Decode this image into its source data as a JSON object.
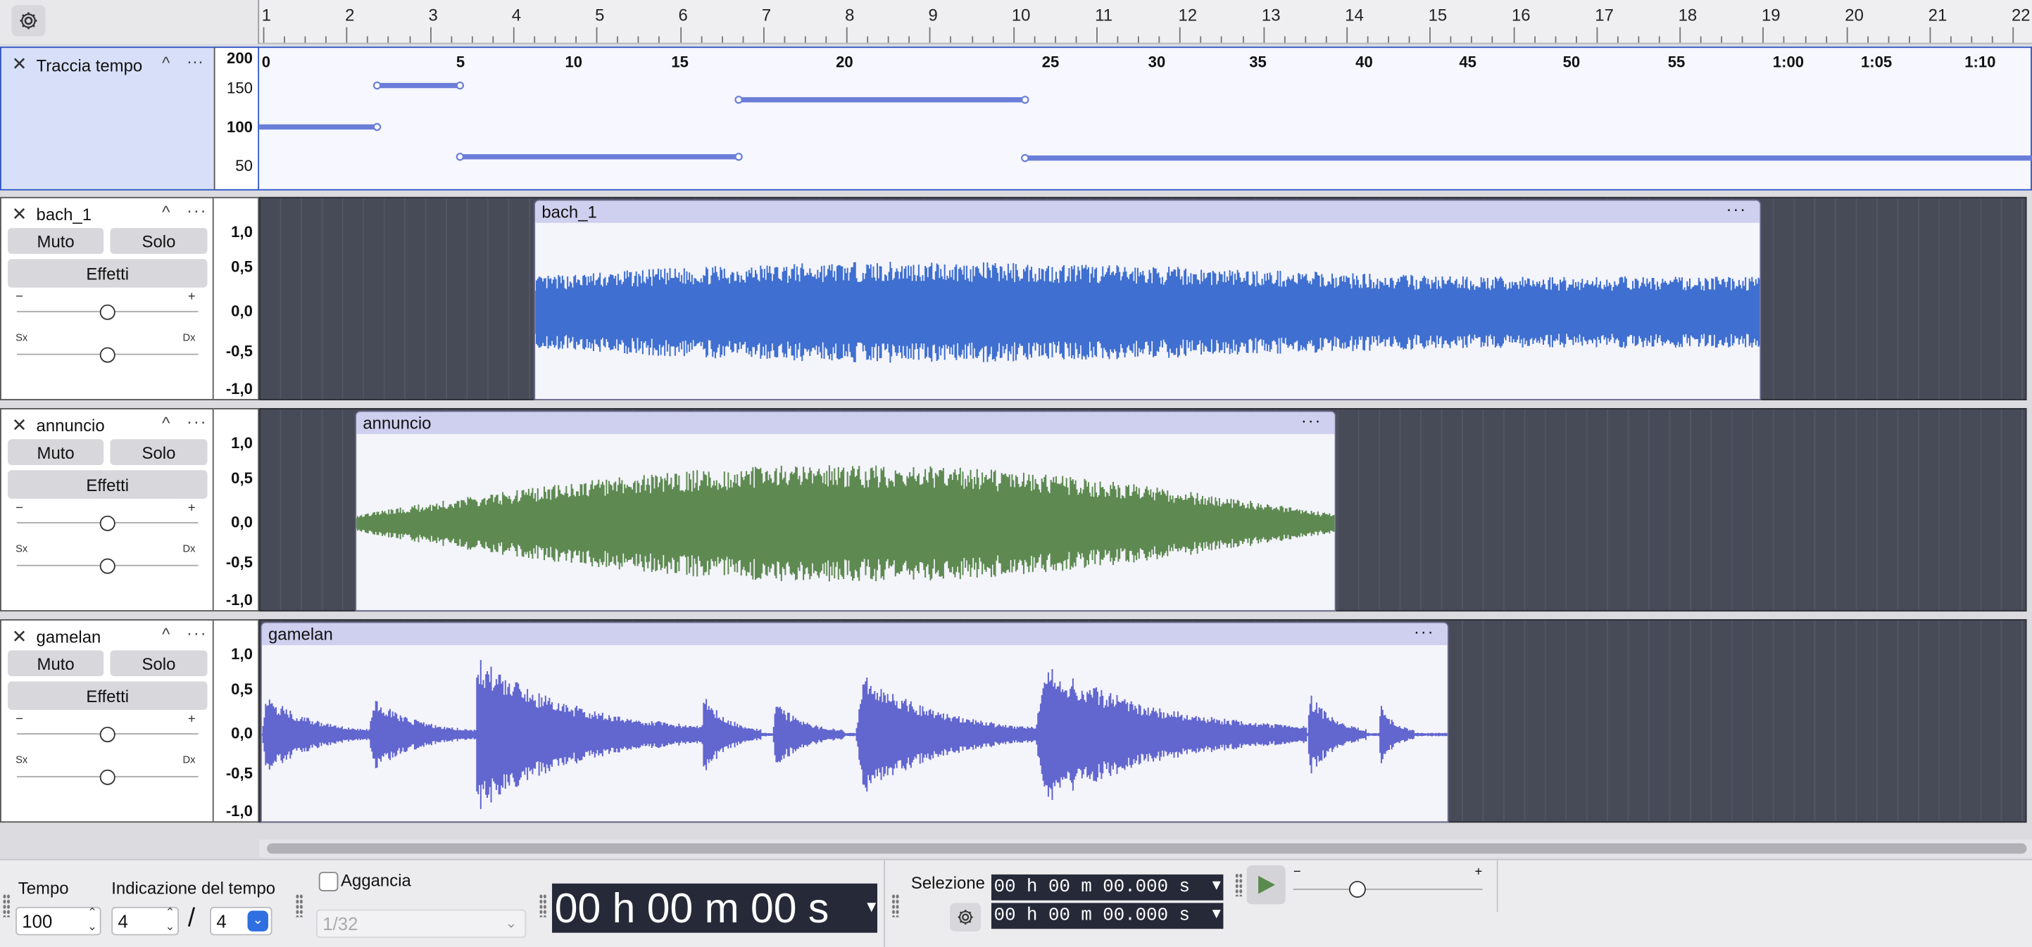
{
  "ruler": {
    "labels": [
      "1",
      "2",
      "3",
      "4",
      "5",
      "6",
      "7",
      "8",
      "9",
      "10",
      "11",
      "12",
      "13",
      "14",
      "15",
      "16",
      "17",
      "18",
      "19",
      "20",
      "21",
      "22"
    ]
  },
  "tempo_track": {
    "name": "Traccia tempo",
    "scale": [
      "200",
      "150",
      "100",
      "50"
    ],
    "time_labels": [
      "0",
      "5",
      "10",
      "15",
      "20",
      "25",
      "30",
      "35",
      "40",
      "45",
      "50",
      "55",
      "1:00",
      "1:05",
      "1:10"
    ]
  },
  "tracks": [
    {
      "name": "bach_1",
      "clip_name": "bach_1",
      "color": "#3f6fd0"
    },
    {
      "name": "annuncio",
      "clip_name": "annuncio",
      "color": "#5e8a52"
    },
    {
      "name": "gamelan",
      "clip_name": "gamelan",
      "color": "#6266cf"
    }
  ],
  "track_controls": {
    "mute": "Muto",
    "solo": "Solo",
    "effects": "Effetti",
    "gain_minus": "−",
    "gain_plus": "+",
    "pan_left": "Sx",
    "pan_right": "Dx",
    "close": "✕",
    "collapse": "^",
    "menu": "···"
  },
  "amp_scale": [
    "1,0",
    "0,5",
    "0,0",
    "-0,5",
    "-1,0"
  ],
  "toolbar": {
    "tempo_label": "Tempo",
    "tempo_value": "100",
    "time_sig_label": "Indicazione del tempo",
    "time_sig_num": "4",
    "time_sig_den": "4",
    "snap_label": "Aggancia",
    "snap_value": "1/32",
    "big_time": "00 h 00 m 00 s",
    "selection_label": "Selezione",
    "sel_start": "00 h 00 m 00.000 s",
    "sel_end": "00 h 00 m 00.000 s",
    "speed_minus": "−",
    "speed_plus": "+"
  }
}
